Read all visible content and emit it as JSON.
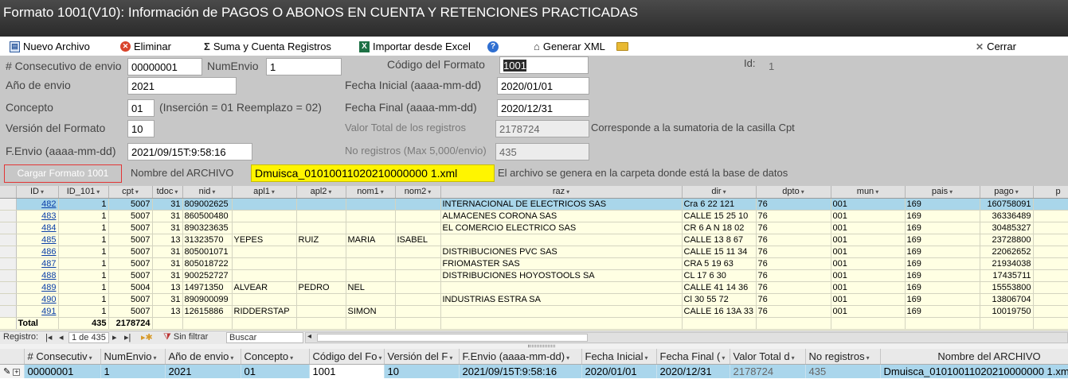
{
  "window": {
    "title": "Formato 1001(V10): Información de PAGOS O ABONOS EN CUENTA Y RETENCIONES PRACTICADAS"
  },
  "toolbar": {
    "nuevo": "Nuevo Archivo",
    "eliminar": "Eliminar",
    "suma": "Suma y Cuenta Registros",
    "importar": "Importar desde Excel",
    "generar": "Generar XML",
    "cerrar": "Cerrar"
  },
  "form": {
    "consecutivo_label": "# Consecutivo de envio",
    "consecutivo": "00000001",
    "numenvio_label": "NumEnvio",
    "numenvio": "1",
    "codigo_label": "Código del Formato",
    "codigo": "1001",
    "id_label": "Id:",
    "id": "1",
    "anio_label": "Año de envio",
    "anio": "2021",
    "fecha_ini_label": "Fecha Inicial (aaaa-mm-dd)",
    "fecha_ini": "2020/01/01",
    "concepto_label": "Concepto",
    "concepto": "01",
    "concepto_hint": "(Inserción = 01 Reemplazo = 02)",
    "fecha_fin_label": "Fecha Final (aaaa-mm-dd)",
    "fecha_fin": "2020/12/31",
    "version_label": "Versión del Formato",
    "version": "10",
    "valor_label": "Valor Total de los registros",
    "valor": "2178724",
    "valor_hint": "Corresponde a la sumatoria de la casilla Cpt",
    "fenvio_label": "F.Envio (aaaa-mm-dd)",
    "fenvio": "2021/09/15T:9:58:16",
    "noreg_label": "No registros (Max 5,000/envio)",
    "noreg": "435",
    "cargar": "Cargar Formato 1001",
    "nombre_label": "Nombre del ARCHIVO",
    "nombre": "Dmuisca_01010011020210000000 1.xml",
    "nombre_hint": "El archivo se genera en la carpeta donde está la base de datos"
  },
  "grid1": {
    "headers": {
      "id": "ID",
      "id101": "ID_101",
      "cpt": "cpt",
      "tdoc": "tdoc",
      "nid": "nid",
      "apl1": "apl1",
      "apl2": "apl2",
      "nom1": "nom1",
      "nom2": "nom2",
      "raz": "raz",
      "dir": "dir",
      "dpto": "dpto",
      "mun": "mun",
      "pais": "pais",
      "pago": "pago",
      "p": "p"
    },
    "rows": [
      {
        "id": "482",
        "id101": "1",
        "cpt": "5007",
        "tdoc": "31",
        "nid": "809002625",
        "apl1": "",
        "apl2": "",
        "nom1": "",
        "nom2": "",
        "raz": "INTERNACIONAL DE ELECTRICOS SAS",
        "dir": "Cra  6  22 121",
        "dpto": "76",
        "mun": "001",
        "pais": "169",
        "pago": "160758091"
      },
      {
        "id": "483",
        "id101": "1",
        "cpt": "5007",
        "tdoc": "31",
        "nid": "860500480",
        "apl1": "",
        "apl2": "",
        "nom1": "",
        "nom2": "",
        "raz": "ALMACENES CORONA SAS",
        "dir": "CALLE 15 25 10",
        "dpto": "76",
        "mun": "001",
        "pais": "169",
        "pago": "36336489"
      },
      {
        "id": "484",
        "id101": "1",
        "cpt": "5007",
        "tdoc": "31",
        "nid": "890323635",
        "apl1": "",
        "apl2": "",
        "nom1": "",
        "nom2": "",
        "raz": "EL COMERCIO ELECTRICO SAS",
        "dir": "CR 6 A N 18 02",
        "dpto": "76",
        "mun": "001",
        "pais": "169",
        "pago": "30485327"
      },
      {
        "id": "485",
        "id101": "1",
        "cpt": "5007",
        "tdoc": "13",
        "nid": "31323570",
        "apl1": "YEPES",
        "apl2": "RUIZ",
        "nom1": "MARIA",
        "nom2": "ISABEL",
        "raz": "",
        "dir": "CALLE 13 8 67",
        "dpto": "76",
        "mun": "001",
        "pais": "169",
        "pago": "23728800"
      },
      {
        "id": "486",
        "id101": "1",
        "cpt": "5007",
        "tdoc": "31",
        "nid": "805001071",
        "apl1": "",
        "apl2": "",
        "nom1": "",
        "nom2": "",
        "raz": "DISTRIBUCIONES PVC SAS",
        "dir": "CALLE 15 11 34",
        "dpto": "76",
        "mun": "001",
        "pais": "169",
        "pago": "22062652"
      },
      {
        "id": "487",
        "id101": "1",
        "cpt": "5007",
        "tdoc": "31",
        "nid": "805018722",
        "apl1": "",
        "apl2": "",
        "nom1": "",
        "nom2": "",
        "raz": "FRIOMASTER SAS",
        "dir": "CRA 5 19 63",
        "dpto": "76",
        "mun": "001",
        "pais": "169",
        "pago": "21934038"
      },
      {
        "id": "488",
        "id101": "1",
        "cpt": "5007",
        "tdoc": "31",
        "nid": "900252727",
        "apl1": "",
        "apl2": "",
        "nom1": "",
        "nom2": "",
        "raz": "DISTRIBUCIONES HOYOSTOOLS SA",
        "dir": "CL 17 6 30",
        "dpto": "76",
        "mun": "001",
        "pais": "169",
        "pago": "17435711"
      },
      {
        "id": "489",
        "id101": "1",
        "cpt": "5004",
        "tdoc": "13",
        "nid": "14971350",
        "apl1": "ALVEAR",
        "apl2": "PEDRO",
        "nom1": "NEL",
        "nom2": "",
        "raz": "",
        "dir": "CALLE 41  14  36",
        "dpto": "76",
        "mun": "001",
        "pais": "169",
        "pago": "15553800"
      },
      {
        "id": "490",
        "id101": "1",
        "cpt": "5007",
        "tdoc": "31",
        "nid": "890900099",
        "apl1": "",
        "apl2": "",
        "nom1": "",
        "nom2": "",
        "raz": "INDUSTRIAS ESTRA SA",
        "dir": "Cl  30   55 72",
        "dpto": "76",
        "mun": "001",
        "pais": "169",
        "pago": "13806704"
      },
      {
        "id": "491",
        "id101": "1",
        "cpt": "5007",
        "tdoc": "13",
        "nid": "12615886",
        "apl1": "RIDDERSTAP",
        "apl2": "",
        "nom1": "SIMON",
        "nom2": "",
        "raz": "",
        "dir": "CALLE 16 13A 33",
        "dpto": "76",
        "mun": "001",
        "pais": "169",
        "pago": "10019750"
      }
    ],
    "total": {
      "label": "Total",
      "id101": "435",
      "cpt": "2178724"
    }
  },
  "nav": {
    "registro": "Registro:",
    "position": "1 de 435",
    "filtro": "Sin filtrar",
    "buscar": "Buscar"
  },
  "grid2": {
    "headers": {
      "consecutivo": "# Consecutiv",
      "numenvio": "NumEnvio",
      "anio": "Año de envio",
      "concepto": "Concepto",
      "codigo": "Código del Fo",
      "version": "Versión del F",
      "fenvio": "F.Envio (aaaa-mm-dd)",
      "fini": "Fecha Inicial",
      "ffin": "Fecha Final (",
      "valor": "Valor Total d",
      "noreg": "No registros",
      "nombre": "Nombre del ARCHIVO"
    },
    "row": {
      "consecutivo": "00000001",
      "numenvio": "1",
      "anio": "2021",
      "concepto": "01",
      "codigo": "1001",
      "version": "10",
      "fenvio": "2021/09/15T:9:58:16",
      "fini": "2020/01/01",
      "ffin": "2020/12/31",
      "valor": "2178724",
      "noreg": "435",
      "nombre": "Dmuisca_01010011020210000000 1.xml"
    }
  }
}
